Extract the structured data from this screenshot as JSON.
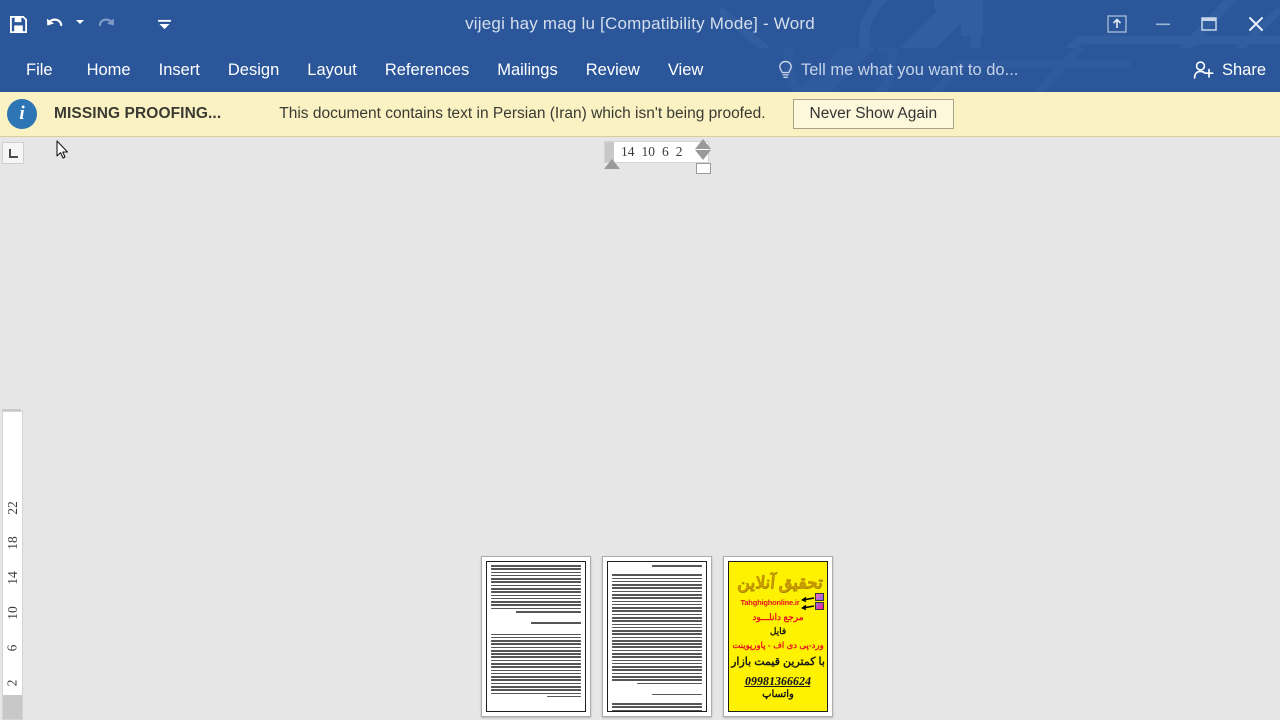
{
  "app": {
    "title": "vijegi hay mag lu [Compatibility Mode] - Word",
    "accent_color": "#2B579A",
    "notification_bg": "#FAF2C3",
    "workspace_bg": "#E6E6E6"
  },
  "quick_access": {
    "save_label": "Save",
    "undo_label": "Undo",
    "undo_dropdown_label": "Undo options",
    "redo_label": "Redo",
    "customize_label": "Customize Quick Access Toolbar"
  },
  "window_controls": {
    "ribbon_display_label": "Ribbon Display Options",
    "minimize_label": "Minimize",
    "restore_label": "Restore Down",
    "close_label": "Close"
  },
  "ribbon": {
    "tabs": [
      {
        "label": "File"
      },
      {
        "label": "Home"
      },
      {
        "label": "Insert"
      },
      {
        "label": "Design"
      },
      {
        "label": "Layout"
      },
      {
        "label": "References"
      },
      {
        "label": "Mailings"
      },
      {
        "label": "Review"
      },
      {
        "label": "View"
      }
    ],
    "tellme_placeholder": "Tell me what you want to do...",
    "share_label": "Share"
  },
  "notification": {
    "icon": "info-icon",
    "icon_glyph": "i",
    "title": "MISSING PROOFING...",
    "message": "This document contains text in Persian (Iran) which isn't being proofed.",
    "button_label": "Never Show Again"
  },
  "ruler": {
    "tabstop_marker": "left-tab-stop",
    "horizontal_ticks": [
      "14",
      "10",
      "6",
      "2"
    ],
    "vertical_ticks": [
      "2",
      "6",
      "10",
      "14",
      "18",
      "22"
    ],
    "vertical_above_tick": "2"
  },
  "document": {
    "pages": [
      {
        "name": "page-1",
        "kind": "text",
        "blocks": [
          {
            "lines": 15,
            "align": "rtl"
          },
          {
            "lines": 1,
            "align": "rtl",
            "heading": true
          },
          {
            "lines": 20,
            "align": "rtl"
          }
        ]
      },
      {
        "name": "page-2",
        "kind": "text",
        "blocks": [
          {
            "lines": 1,
            "align": "rtl",
            "heading": true
          },
          {
            "lines": 34,
            "align": "rtl"
          },
          {
            "lines": 1,
            "align": "rtl",
            "heading": true
          },
          {
            "lines": 5,
            "align": "rtl"
          }
        ]
      },
      {
        "name": "page-3-advertisement",
        "kind": "advertisement",
        "background_color": "#FFF200",
        "logo_text": "تحقیق آنلاین",
        "url_text": "Tahghighonline.ir",
        "line_1": "مرجع دانلـــود",
        "line_2": "فایل",
        "line_3": "ورد-پی دی اف - پاورپوینت",
        "line_4": "با کمترین قیمت بازار",
        "line_5_label": "واتساپ",
        "line_5_phone": "09981366624"
      }
    ]
  }
}
